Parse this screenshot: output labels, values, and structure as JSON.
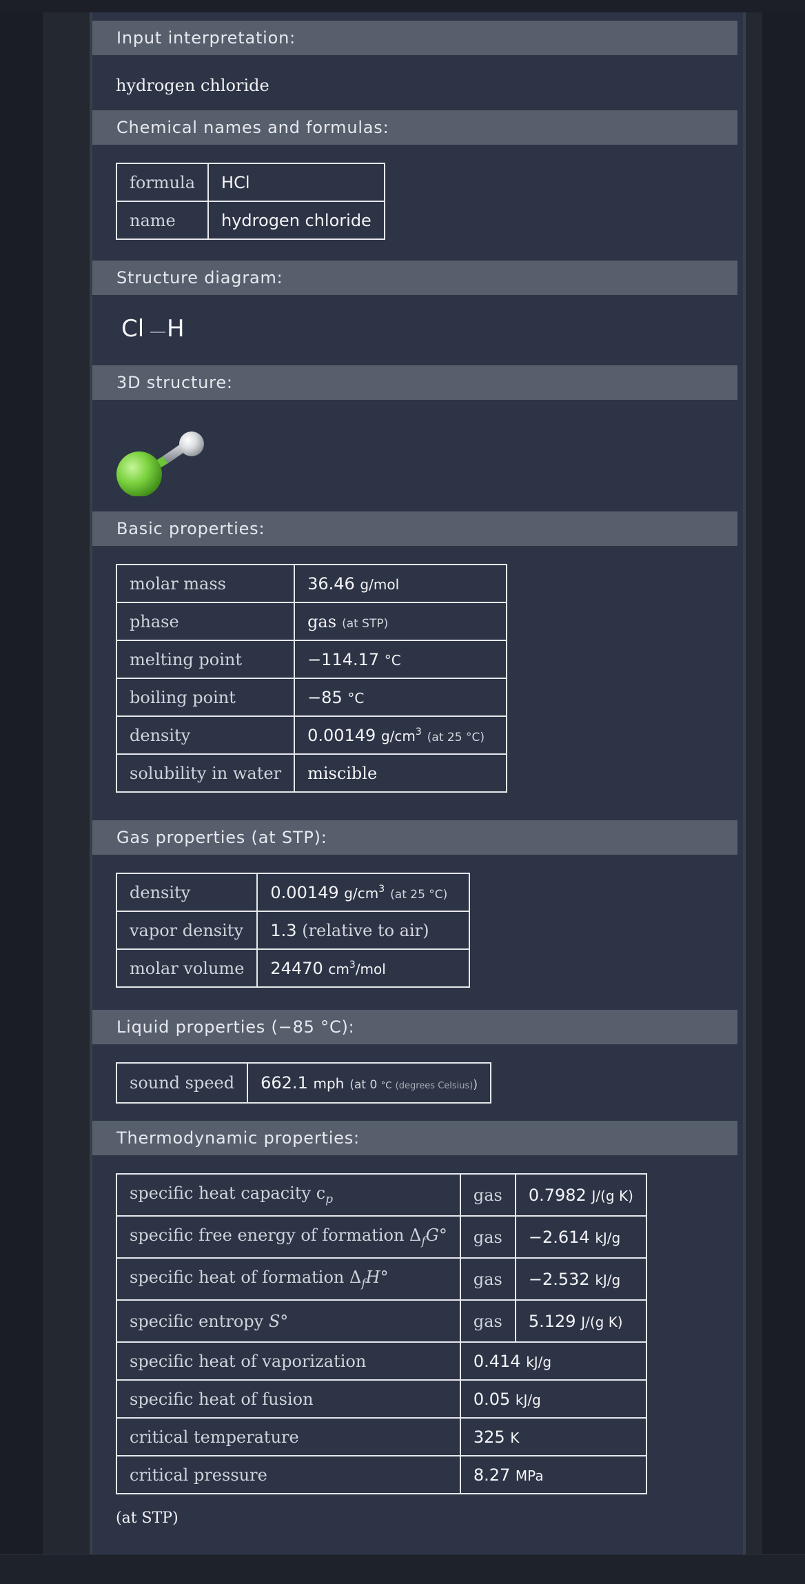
{
  "sections": {
    "input": {
      "title": "Input interpretation:",
      "value": "hydrogen chloride"
    },
    "names": {
      "title": "Chemical names and formulas:",
      "rows": [
        {
          "label": "formula",
          "value": "HCl"
        },
        {
          "label": "name",
          "value": "hydrogen chloride"
        }
      ]
    },
    "structure": {
      "title": "Structure diagram:",
      "atom1": "Cl",
      "atom2": "H"
    },
    "structure3d": {
      "title": "3D structure:",
      "atom_colors": {
        "cl": "#7bd23f",
        "h": "#d9dbde",
        "bond": "#b0b4ba"
      }
    },
    "basic": {
      "title": "Basic properties:",
      "rows": [
        {
          "label": "molar mass",
          "num": "36.46",
          "unit": "g/mol",
          "note": ""
        },
        {
          "label": "phase",
          "num": "gas",
          "unit": "",
          "note": "(at STP)"
        },
        {
          "label": "melting point",
          "num": "−114.17",
          "unit": "°C",
          "note": ""
        },
        {
          "label": "boiling point",
          "num": "−85",
          "unit": "°C",
          "note": ""
        },
        {
          "label": "density",
          "num": "0.00149",
          "unit": "g/cm",
          "sup": "3",
          "note": "(at 25 °C)"
        },
        {
          "label": "solubility in water",
          "num": "miscible",
          "unit": "",
          "note": ""
        }
      ]
    },
    "gas": {
      "title": "Gas properties (at STP):",
      "rows": [
        {
          "label": "density",
          "num": "0.00149",
          "unit": "g/cm",
          "sup": "3",
          "note": "(at 25 °C)"
        },
        {
          "label": "vapor density",
          "num": "1.3",
          "extra": "(relative to air)"
        },
        {
          "label": "molar volume",
          "num": "24470",
          "unit": "cm",
          "sup": "3",
          "unit2": "/mol"
        }
      ]
    },
    "liquid": {
      "title": "Liquid properties (−85 °C):",
      "rows": [
        {
          "label": "sound speed",
          "num": "662.1",
          "unit": "mph",
          "note_open": "(at 0",
          "note_deg": "°C",
          "note_desc": "(degrees Celsius)",
          "note_close": ")"
        }
      ]
    },
    "thermo": {
      "title": "Thermodynamic properties:",
      "rows": [
        {
          "label": "specific heat capacity c",
          "sub": "p",
          "phase": "gas",
          "num": "0.7982",
          "unit": "J/(g K)"
        },
        {
          "label": "specific free energy of formation Δ",
          "sub": "f",
          "italic": "G°",
          "phase": "gas",
          "num": "−2.614",
          "unit": "kJ/g"
        },
        {
          "label": "specific heat of formation Δ",
          "sub": "f",
          "italic": "H°",
          "phase": "gas",
          "num": "−2.532",
          "unit": "kJ/g"
        },
        {
          "label": "specific entropy ",
          "italic": "S°",
          "phase": "gas",
          "num": "5.129",
          "unit": "J/(g K)"
        },
        {
          "label": "specific heat of vaporization",
          "num": "0.414",
          "unit": "kJ/g"
        },
        {
          "label": "specific heat of fusion",
          "num": "0.05",
          "unit": "kJ/g"
        },
        {
          "label": "critical temperature",
          "num": "325",
          "unit": "K"
        },
        {
          "label": "critical pressure",
          "num": "8.27",
          "unit": "MPa"
        }
      ],
      "footnote": "(at STP)"
    }
  }
}
